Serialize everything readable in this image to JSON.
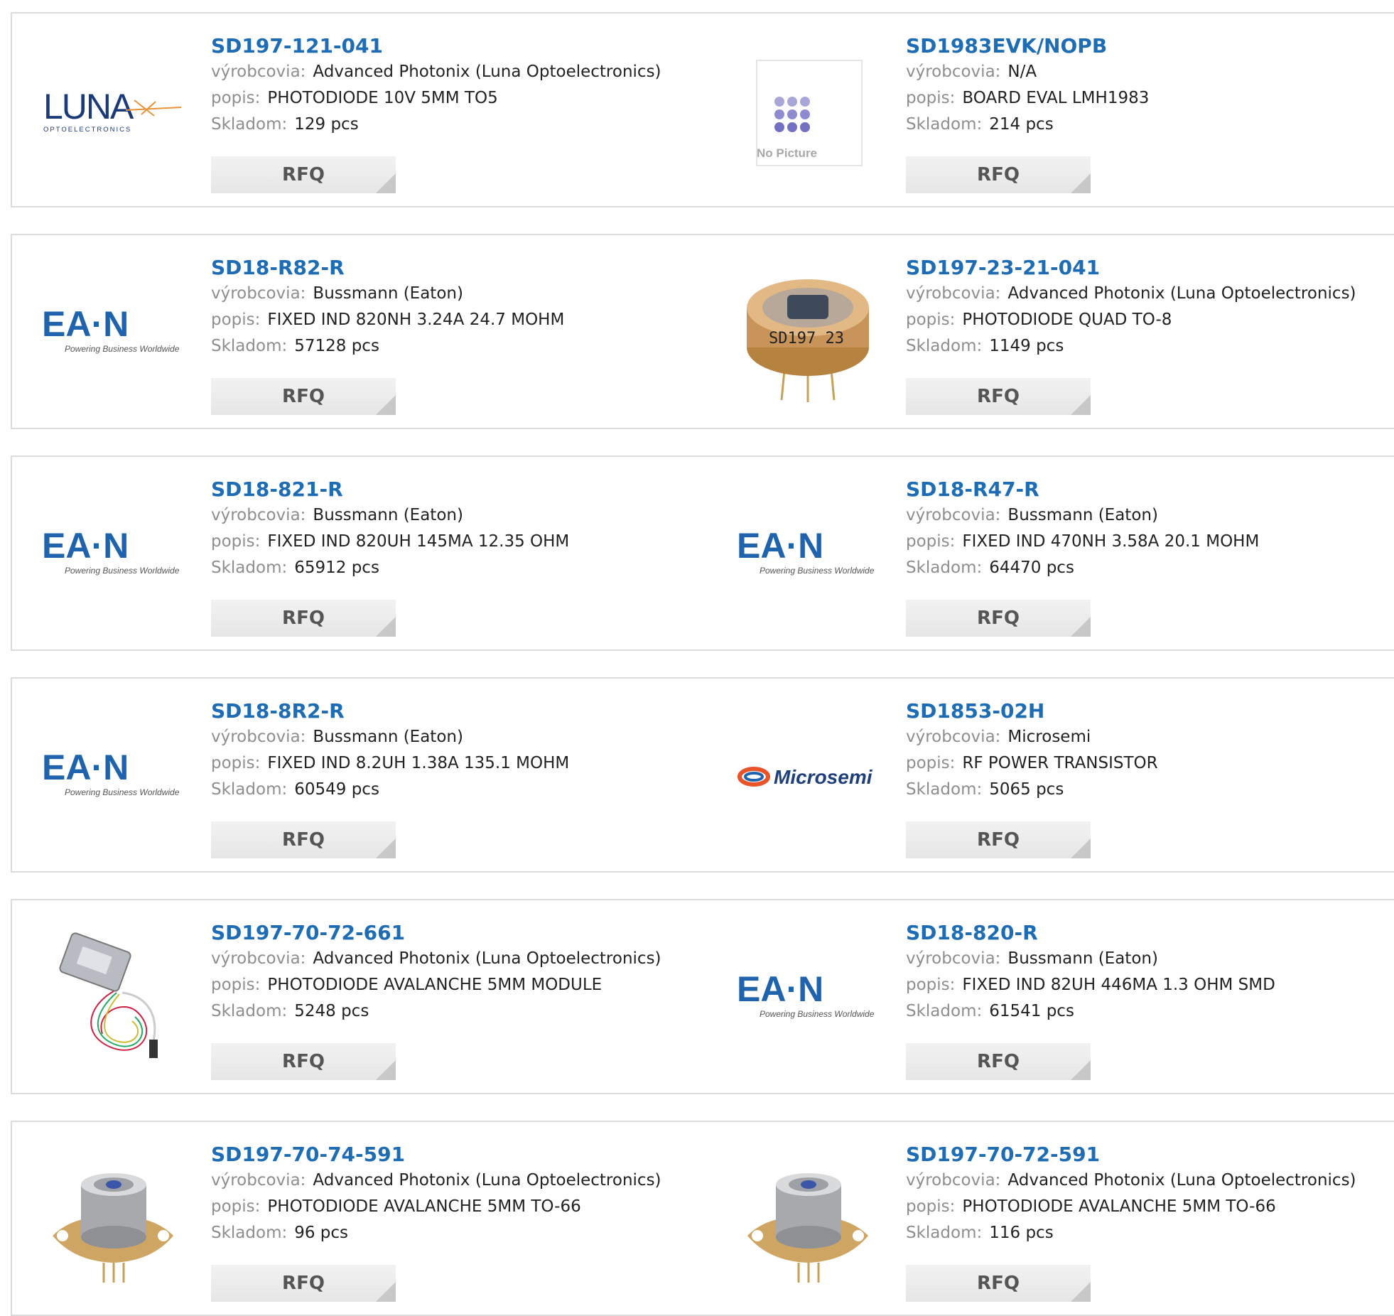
{
  "labels": {
    "manufacturer": "výrobcovia:",
    "description": "popis:",
    "stock": "Skladom:",
    "rfq": "RFQ"
  },
  "logos": {
    "luna": {
      "text": "LUNA",
      "sub": "OPTOELECTRONICS"
    },
    "eaton": {
      "text": "EA·N",
      "sub": "Powering Business Worldwide"
    },
    "microsemi": {
      "text": "Microsemi"
    },
    "nopicture": {
      "text": "No Picture"
    }
  },
  "colors": {
    "link": "#1e6db4",
    "label": "#8e8e8e",
    "border": "#dcdcdc",
    "rfq_bg": "#eeeeee",
    "eaton_blue": "#1f63ad"
  },
  "products": [
    {
      "part": "SD197-121-041",
      "manufacturer": "Advanced Photonix (Luna Optoelectronics)",
      "description": "PHOTODIODE 10V 5MM TO5",
      "stock": "129 pcs",
      "image": "luna-logo"
    },
    {
      "part": "SD1983EVK/NOPB",
      "manufacturer": "N/A",
      "description": "BOARD EVAL LMH1983",
      "stock": "214 pcs",
      "image": "no-picture"
    },
    {
      "part": "SD18-R82-R",
      "manufacturer": "Bussmann (Eaton)",
      "description": "FIXED IND 820NH 3.24A 24.7 MOHM",
      "stock": "57128 pcs",
      "image": "eaton-logo"
    },
    {
      "part": "SD197-23-21-041",
      "manufacturer": "Advanced Photonix (Luna Optoelectronics)",
      "description": "PHOTODIODE QUAD TO-8",
      "stock": "1149 pcs",
      "image": "photodiode-to8"
    },
    {
      "part": "SD18-821-R",
      "manufacturer": "Bussmann (Eaton)",
      "description": "FIXED IND 820UH 145MA 12.35 OHM",
      "stock": "65912 pcs",
      "image": "eaton-logo"
    },
    {
      "part": "SD18-R47-R",
      "manufacturer": "Bussmann (Eaton)",
      "description": "FIXED IND 470NH 3.58A 20.1 MOHM",
      "stock": "64470 pcs",
      "image": "eaton-logo"
    },
    {
      "part": "SD18-8R2-R",
      "manufacturer": "Bussmann (Eaton)",
      "description": "FIXED IND 8.2UH 1.38A 135.1 MOHM",
      "stock": "60549 pcs",
      "image": "eaton-logo"
    },
    {
      "part": "SD1853-02H",
      "manufacturer": "Microsemi",
      "description": "RF POWER TRANSISTOR",
      "stock": "5065 pcs",
      "image": "microsemi-logo"
    },
    {
      "part": "SD197-70-72-661",
      "manufacturer": "Advanced Photonix (Luna Optoelectronics)",
      "description": "PHOTODIODE AVALANCHE 5MM MODULE",
      "stock": "5248 pcs",
      "image": "apd-module"
    },
    {
      "part": "SD18-820-R",
      "manufacturer": "Bussmann (Eaton)",
      "description": "FIXED IND 82UH 446MA 1.3 OHM SMD",
      "stock": "61541 pcs",
      "image": "eaton-logo"
    },
    {
      "part": "SD197-70-74-591",
      "manufacturer": "Advanced Photonix (Luna Optoelectronics)",
      "description": "PHOTODIODE AVALANCHE 5MM TO-66",
      "stock": "96 pcs",
      "image": "photodiode-to66"
    },
    {
      "part": "SD197-70-72-591",
      "manufacturer": "Advanced Photonix (Luna Optoelectronics)",
      "description": "PHOTODIODE AVALANCHE 5MM TO-66",
      "stock": "116 pcs",
      "image": "photodiode-to66"
    }
  ]
}
